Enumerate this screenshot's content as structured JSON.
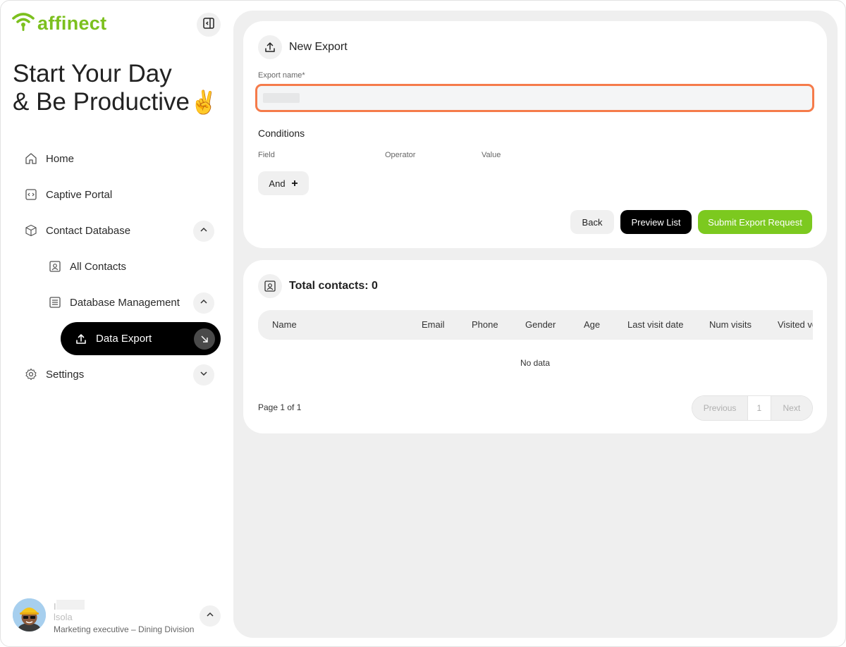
{
  "brand": {
    "name": "affinect",
    "color": "#7cc01e"
  },
  "headline": {
    "line1": "Start Your Day",
    "line2": "& Be Productive",
    "emoji": "✌️"
  },
  "nav": {
    "home": "Home",
    "captive_portal": "Captive Portal",
    "contact_database": "Contact Database",
    "all_contacts": "All Contacts",
    "database_management": "Database Management",
    "data_export": "Data Export",
    "settings": "Settings"
  },
  "user": {
    "name_visible": "I",
    "name_second": "lsola",
    "role": "Marketing executive – Dining Division"
  },
  "export_form": {
    "title": "New Export",
    "name_label": "Export name*",
    "name_value": "",
    "conditions_title": "Conditions",
    "col_field": "Field",
    "col_operator": "Operator",
    "col_value": "Value",
    "and_label": "And",
    "back_label": "Back",
    "preview_label": "Preview List",
    "submit_label": "Submit Export Request",
    "submit_color": "#7cc91f",
    "focus_color": "#f57b4a"
  },
  "contacts": {
    "title": "Total contacts: 0",
    "columns": [
      "Name",
      "Email",
      "Phone",
      "Gender",
      "Age",
      "Last visit date",
      "Num visits",
      "Visited ve"
    ],
    "empty_text": "No data",
    "page_info": "Page 1 of 1",
    "pager": {
      "previous": "Previous",
      "current": "1",
      "next": "Next"
    }
  }
}
